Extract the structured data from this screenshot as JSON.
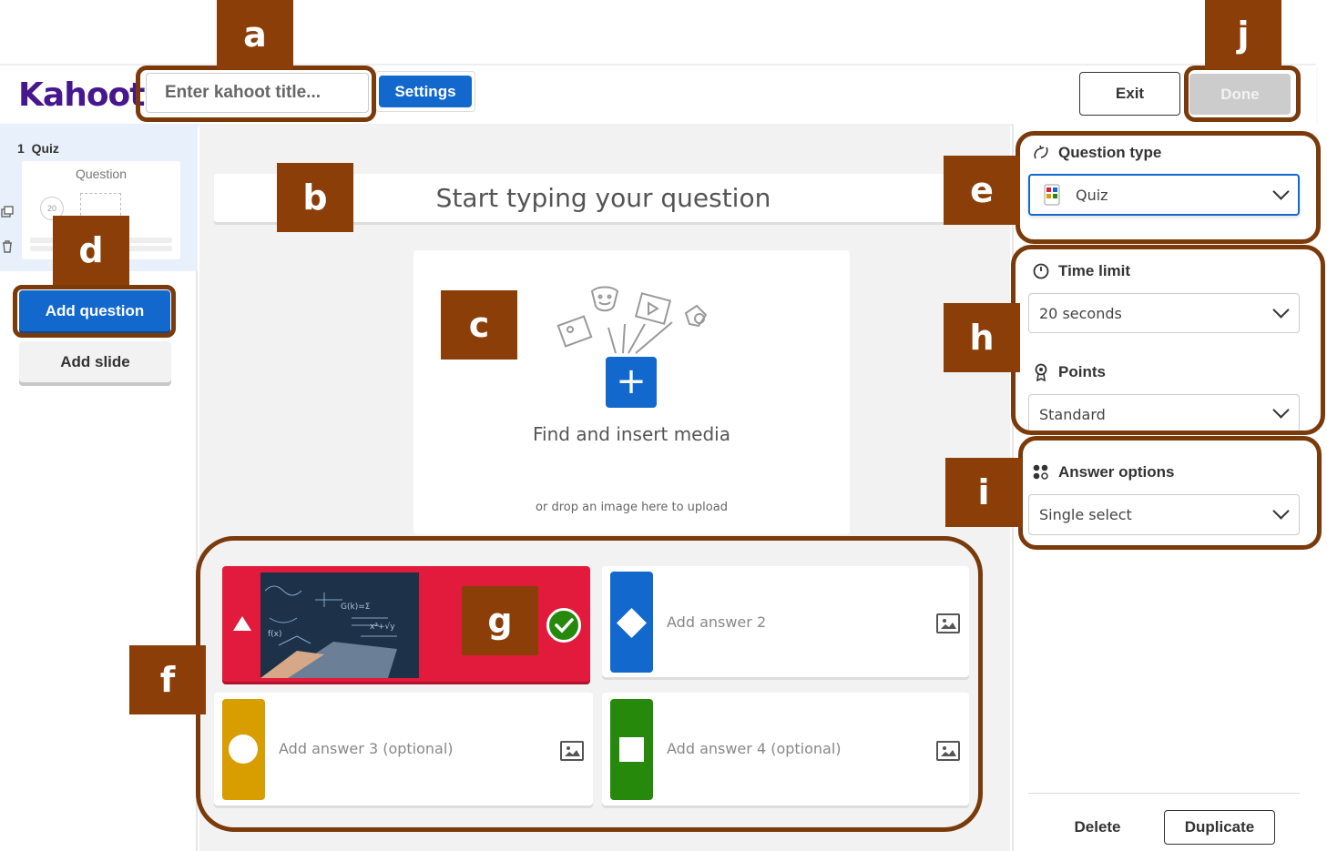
{
  "header": {
    "logo": "Kahoot!",
    "title_placeholder": "Enter kahoot title...",
    "settings_label": "Settings",
    "exit_label": "Exit",
    "done_label": "Done"
  },
  "sidebar": {
    "slide_number": "1",
    "slide_type": "Quiz",
    "thumb_title": "Question",
    "thumb_timer": "20",
    "add_question_label": "Add question",
    "add_slide_label": "Add slide"
  },
  "editor": {
    "question_placeholder": "Start typing your question",
    "media_title": "Find and insert media",
    "media_subtitle": "or drop an image here to upload",
    "answers": [
      {
        "text": "",
        "color": "#e21b3c",
        "shape": "triangle",
        "correct": true
      },
      {
        "text": "Add answer 2",
        "color": "#1368ce",
        "shape": "diamond"
      },
      {
        "text": "Add answer 3 (optional)",
        "color": "#d89e00",
        "shape": "circle"
      },
      {
        "text": "Add answer 4 (optional)",
        "color": "#26890c",
        "shape": "square"
      }
    ]
  },
  "right_panel": {
    "question_type_label": "Question type",
    "question_type_value": "Quiz",
    "time_limit_label": "Time limit",
    "time_limit_value": "20 seconds",
    "points_label": "Points",
    "points_value": "Standard",
    "answer_options_label": "Answer options",
    "answer_options_value": "Single select",
    "delete_label": "Delete",
    "duplicate_label": "Duplicate"
  },
  "annotations": [
    "a",
    "b",
    "c",
    "d",
    "e",
    "f",
    "g",
    "h",
    "i",
    "j"
  ],
  "colors": {
    "brand": "#46178f",
    "primary_blue": "#1368ce",
    "annotation": "#8b3e08"
  }
}
